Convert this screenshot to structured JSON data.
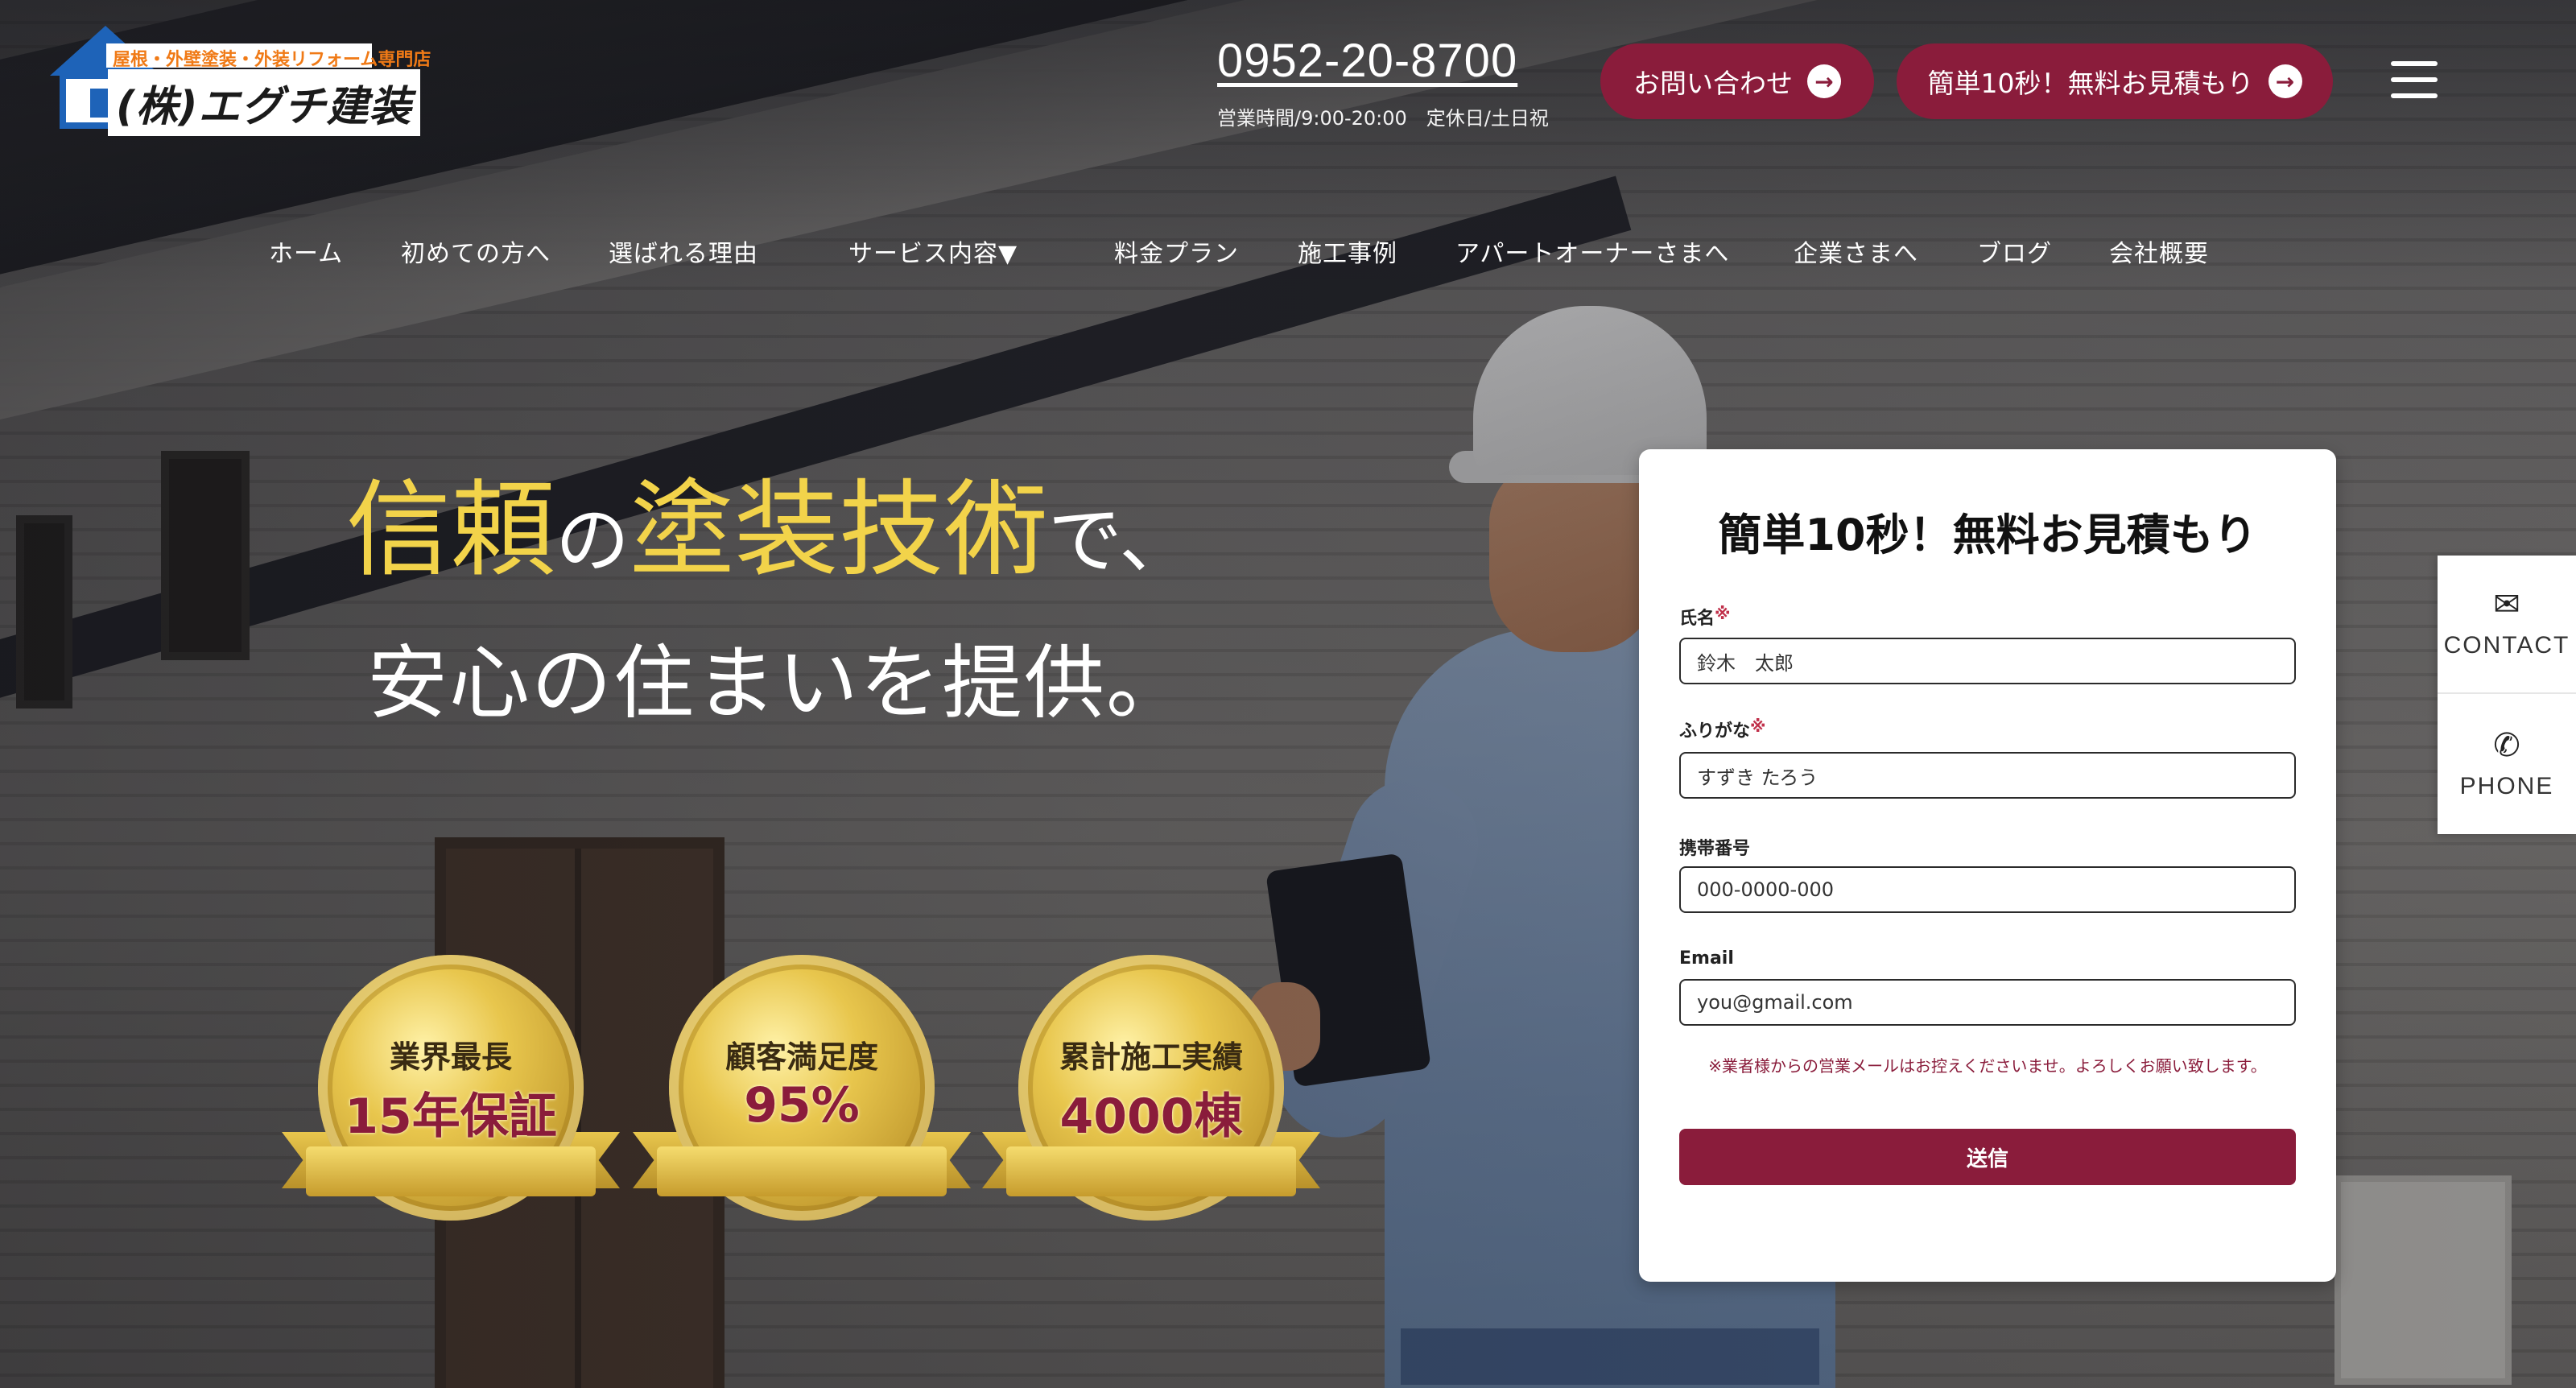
{
  "brand": {
    "tagline": "屋根・外壁塗装・外装リフォーム専門店",
    "name": "(株)エグチ建装"
  },
  "header": {
    "phone": "0952-20-8700",
    "hours": "営業時間/9:00-20:00　定休日/土日祝",
    "contact_button": "お問い合わせ",
    "estimate_button": "簡単10秒！無料お見積もり"
  },
  "nav": {
    "items": [
      {
        "label": "ホーム"
      },
      {
        "label": "初めての方へ"
      },
      {
        "label": "選ばれる理由"
      },
      {
        "label": "サービス内容▼"
      },
      {
        "label": "料金プラン"
      },
      {
        "label": "施工事例"
      },
      {
        "label": "アパートオーナーさまへ"
      },
      {
        "label": "企業さまへ"
      },
      {
        "label": "ブログ"
      },
      {
        "label": "会社概要"
      }
    ]
  },
  "hero": {
    "headline_part1": "信頼",
    "headline_part2": "の",
    "headline_part3": "塗装技術",
    "headline_part4": "で、",
    "headline_line2": "安心の住まいを提供。"
  },
  "medals": [
    {
      "top": "業界最長",
      "big": "15年保証"
    },
    {
      "top": "顧客満足度",
      "big": "95%"
    },
    {
      "top": "累計施工実績",
      "big": "4000棟"
    }
  ],
  "form": {
    "title": "簡単10秒！無料お見積もり",
    "required_mark": "※",
    "name_label": "氏名",
    "name_placeholder": "鈴木　太郎",
    "kana_label": "ふりがな",
    "kana_placeholder": "すずき たろう",
    "mobile_label": "携帯番号",
    "mobile_placeholder": "000-0000-000",
    "email_label": "Email",
    "email_placeholder": "you@gmail.com",
    "notice": "※業者様からの営業メールはお控えくださいませ。よろしくお願い致します。",
    "submit": "送信"
  },
  "side_tabs": {
    "contact": "CONTACT",
    "phone": "PHONE"
  },
  "colors": {
    "accent": "#8a1c3b",
    "headline_gold": "#f2d34a",
    "form_bg": "#ffffff"
  }
}
